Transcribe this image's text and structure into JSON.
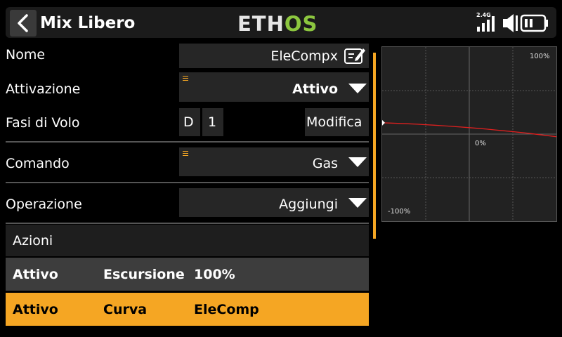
{
  "header": {
    "title": "Mix Libero",
    "logo": {
      "part1": "ETH",
      "part2": "OS"
    },
    "band": "2.4G"
  },
  "form": {
    "nome": {
      "label": "Nome",
      "value": "EleCompx"
    },
    "attivazione": {
      "label": "Attivazione",
      "value": "Attivo"
    },
    "fasi": {
      "label": "Fasi di Volo",
      "d": "D",
      "n": "1",
      "button": "Modifica"
    },
    "comando": {
      "label": "Comando",
      "value": "Gas"
    },
    "operazione": {
      "label": "Operazione",
      "value": "Aggiungi"
    }
  },
  "actions": {
    "header": "Azioni",
    "rows": [
      {
        "state": "Attivo",
        "type": "Escursione",
        "value": "100%"
      },
      {
        "state": "Attivo",
        "type": "Curva",
        "value": "EleComp"
      }
    ]
  },
  "graph": {
    "label_top": "100%",
    "label_mid": "0%",
    "label_bottom": "-100%",
    "curve_color": "#e0201f",
    "curve_start_percent": 13,
    "curve_end_percent": -3
  },
  "colors": {
    "accent": "#f5a623",
    "logo_green": "#8cc63f"
  }
}
